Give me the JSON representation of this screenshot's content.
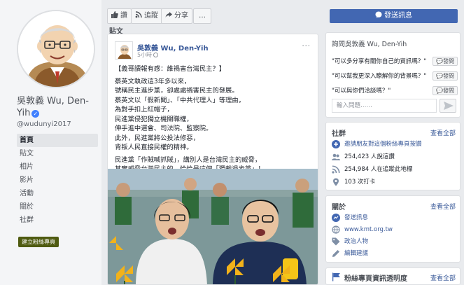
{
  "page": {
    "name_line1": "吳敦義 Wu, Den-",
    "name_line2": "Yih",
    "handle": "@wudunyi2017",
    "nav": [
      "首頁",
      "貼文",
      "相片",
      "影片",
      "活動",
      "關於",
      "社群"
    ],
    "create_page": "建立粉絲專頁"
  },
  "actions": {
    "like": "讚",
    "follow": "追蹤",
    "share": "分享",
    "more": "…"
  },
  "post": {
    "section_label": "貼文",
    "author": "吳敦義 Wu, Den-Yih",
    "time": "5小時",
    "menu": "···",
    "lines_a": [
      "【義哥讀報有感：誰禍害台灣民主？】"
    ],
    "lines_b": [
      "蔡英文執政這3年多以來，",
      "號稱民主進步黨，卻處處禍害民主的發展。",
      "蔡英文以「假新聞」、「中共代理人」等理由，",
      "為對手扣上紅帽子，",
      "民進黨侵犯獨立機關職權，",
      "伸手進中選會、司法院、監察院。",
      "此外，民進黨將公投法修惡，",
      "背叛人民直接民權的精神。"
    ],
    "lines_c": [
      "民進黨「作賊喊抓賊」，講別人是台灣民主的威脅，",
      "其實威脅台灣民主的，恰恰是這個「獨裁退步黨」！"
    ]
  },
  "sidebar": {
    "send_message": "發送訊息",
    "ask_title": "詢問吳敦義 Wu, Den-Yih",
    "questions": [
      "\"可以多分享有關你自己的資訊嗎？\"",
      "\"可以幫我更深入瞭解你的背景嗎？\"",
      "\"可以與你們洽談嗎？\""
    ],
    "ask_label": "發問",
    "input_placeholder": "輸入問題……",
    "community": {
      "title": "社群",
      "see_all": "查看全部",
      "rows": [
        "邀請朋友對這個粉絲專頁按讚",
        "254,423 人說這讚",
        "254,984 人在追蹤此地標",
        "103 次打卡"
      ]
    },
    "about": {
      "title": "關於",
      "see_all": "查看全部",
      "rows": [
        "發送訊息",
        "www.kmt.org.tw",
        "政治人物",
        "編輯建議"
      ]
    },
    "transparency": "粉絲專頁資訊透明度",
    "transparency_see_all": "查看全部"
  },
  "colors": {
    "brand_blue": "#4267b2",
    "link_blue": "#385898",
    "create_button_olive": "#4f5b11"
  }
}
